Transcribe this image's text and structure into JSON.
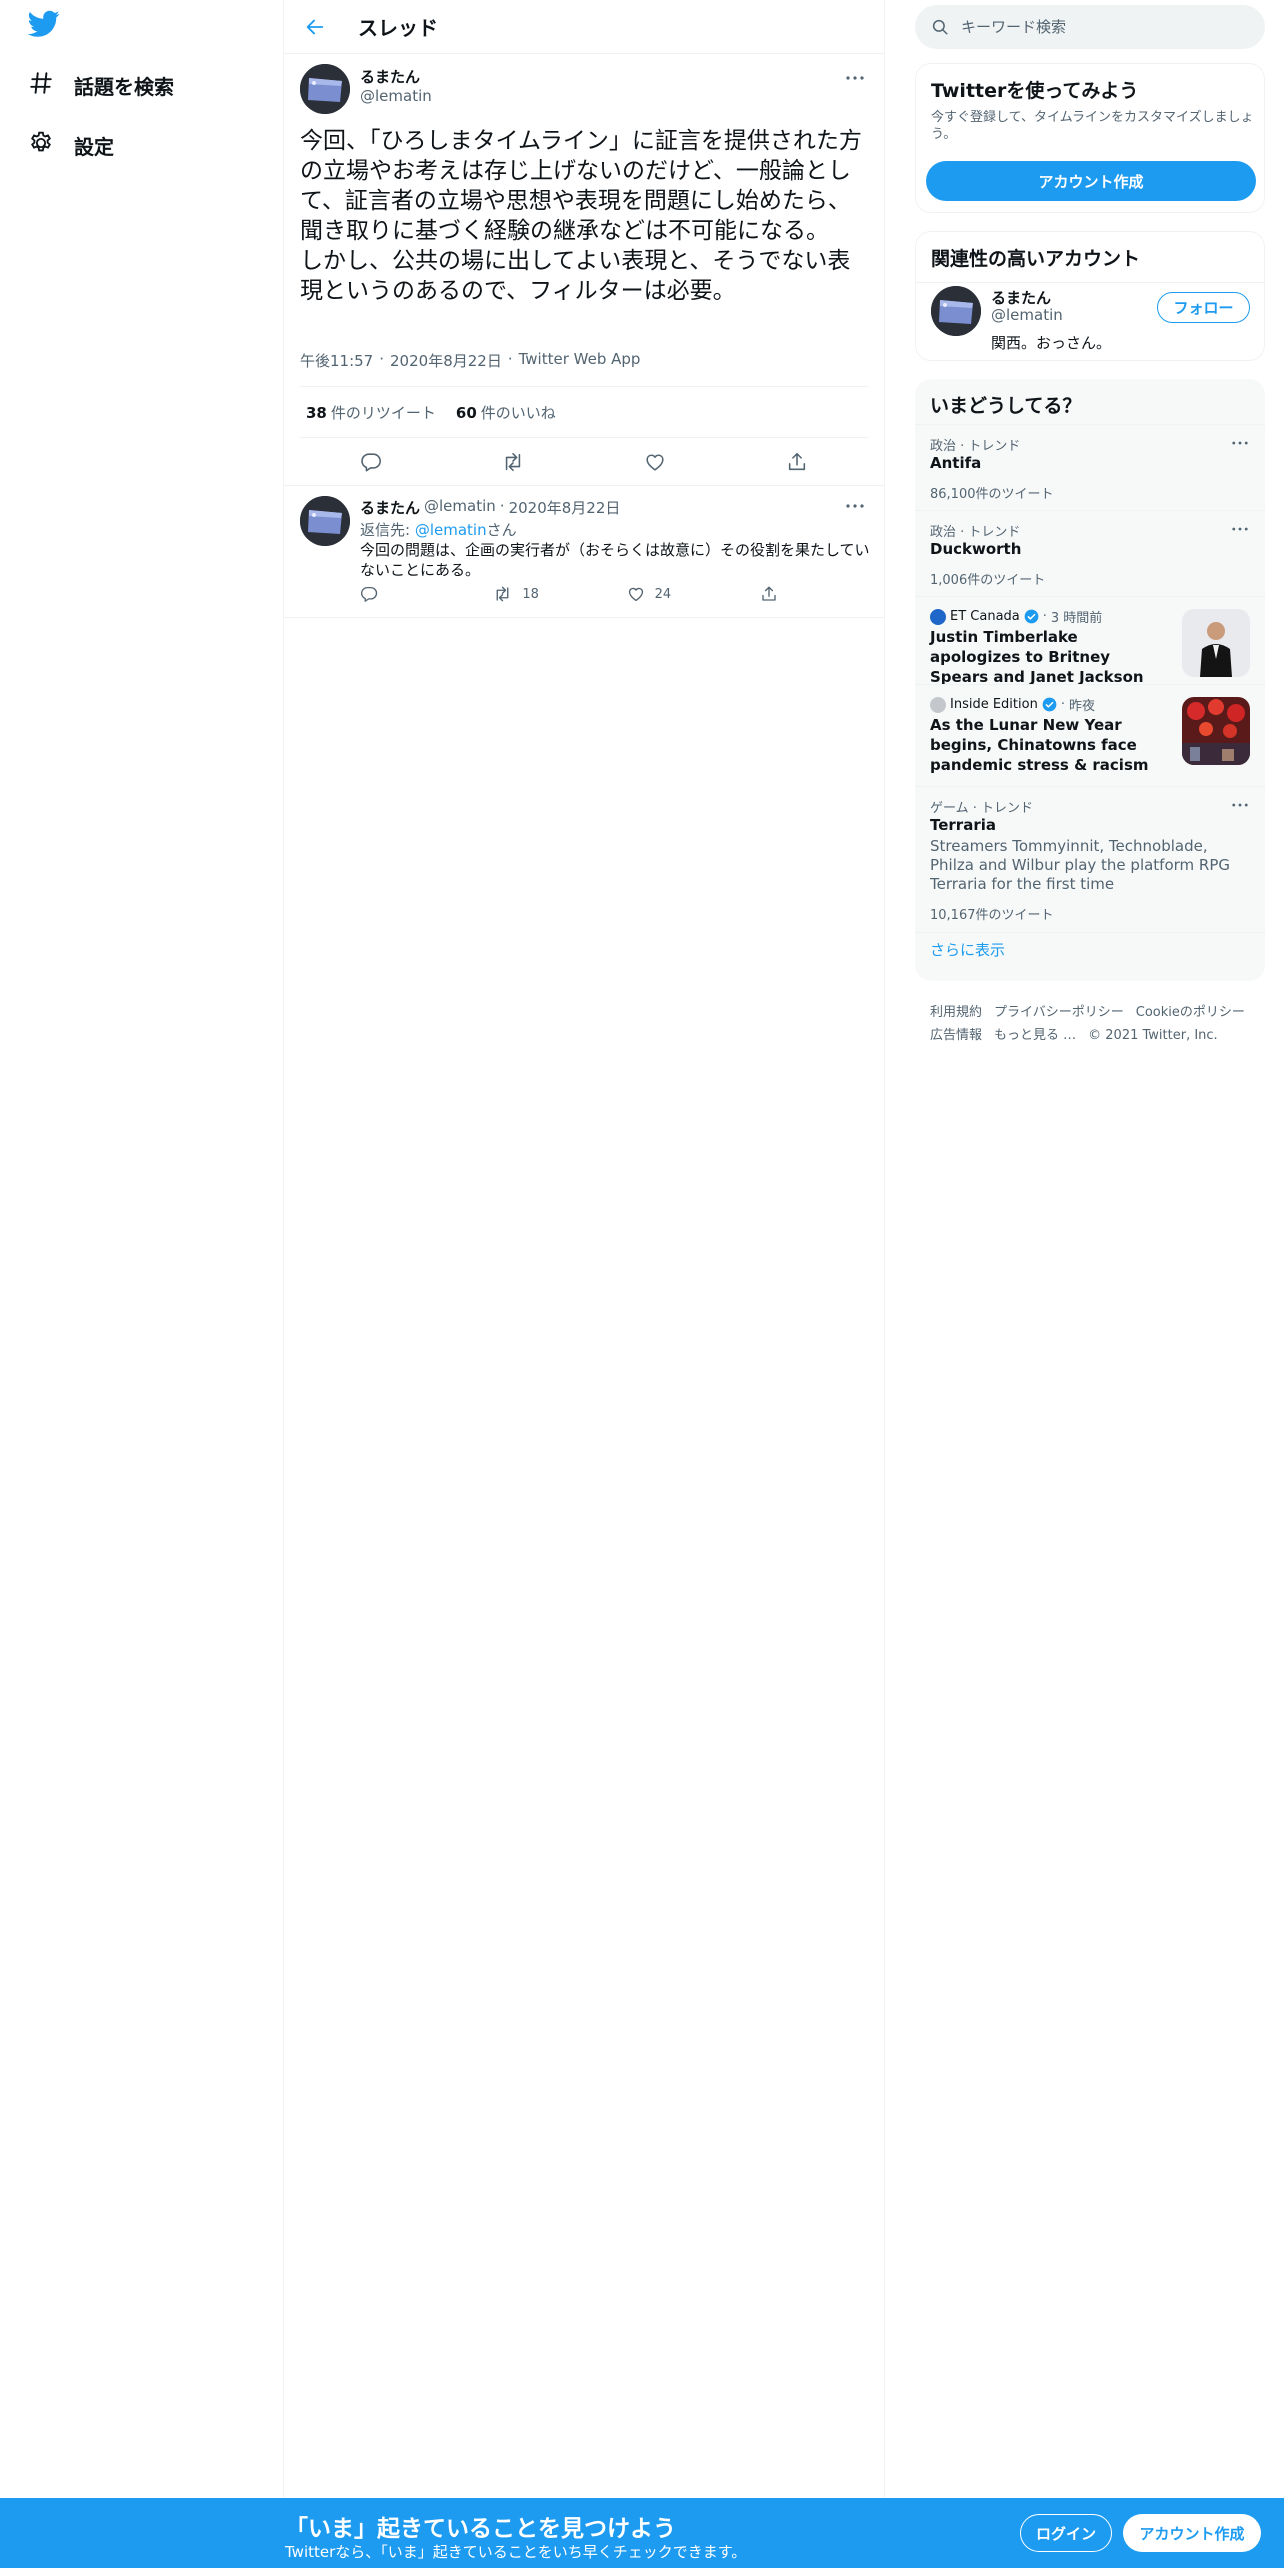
{
  "colors": {
    "accent": "#1d9bf0",
    "text": "#0f1419",
    "muted": "#536471",
    "border": "#eff3f4"
  },
  "nav": {
    "logo_icon": "twitter-bird-icon",
    "items": [
      {
        "icon": "hashtag-icon",
        "label": "話題を検索"
      },
      {
        "icon": "gear-icon",
        "label": "設定"
      }
    ]
  },
  "header": {
    "title": "スレッド"
  },
  "tweet": {
    "name": "るまたん",
    "handle": "@lematin",
    "text": "今回、「ひろしまタイムライン」に証言を提供された方の立場やお考えは存じ上げないのだけど、一般論として、証言者の立場や思想や表現を問題にし始めたら、聞き取りに基づく経験の継承などは不可能になる。\nしかし、公共の場に出してよい表現と、そうでない表現というのあるので、フィルターは必要。",
    "time": "午後11:57",
    "date": "2020年8月22日",
    "source": "Twitter Web App",
    "sep": "·",
    "retweets": "38",
    "retweets_label": "件のリツイート",
    "likes": "60",
    "likes_label": "件のいいね"
  },
  "reply": {
    "name": "るまたん",
    "handle": "@lematin",
    "sep": "·",
    "date": "2020年8月22日",
    "replying_prefix": "返信先: ",
    "replying_mention": "@lematin",
    "replying_suffix": "さん",
    "text": "今回の問題は、企画の実行者が（おそらくは故意に）その役割を果たしていないことにある。",
    "retweets": "18",
    "likes": "24"
  },
  "search": {
    "placeholder": "キーワード検索"
  },
  "signup_card": {
    "title": "Twitterを使ってみよう",
    "subtitle": "今すぐ登録して、タイムラインをカスタマイズしましょう。",
    "button": "アカウント作成"
  },
  "related": {
    "title": "関連性の高いアカウント",
    "name": "るまたん",
    "handle": "@lematin",
    "bio": "関西。おっさん。",
    "follow": "フォロー"
  },
  "trends": {
    "title": "いまどうしてる？",
    "items": [
      {
        "context": "政治 · トレンド",
        "name": "Antifa",
        "count": "86,100件のツイート"
      },
      {
        "context": "政治 · トレンド",
        "name": "Duckworth",
        "count": "1,006件のツイート"
      },
      {
        "source": "ET Canada",
        "sep": "·",
        "time": "3 時間前",
        "headline": "Justin Timberlake apologizes to Britney Spears and Janet Jackson"
      },
      {
        "source": "Inside Edition",
        "sep": "·",
        "time": "昨夜",
        "headline": "As the Lunar New Year begins, Chinatowns face pandemic stress & racism"
      },
      {
        "context": "ゲーム · トレンド",
        "name": "Terraria",
        "description": "Streamers Tommyinnit, Technoblade, Philza and Wilbur play the platform RPG Terraria for the first time",
        "count": "10,167件のツイート"
      }
    ],
    "show_more": "さらに表示"
  },
  "footer": {
    "links": [
      "利用規約",
      "プライバシーポリシー",
      "Cookieのポリシー",
      "広告情報",
      "もっと見る …"
    ],
    "copyright": "© 2021 Twitter, Inc."
  },
  "bottom_bar": {
    "title": "「いま」起きていることを見つけよう",
    "subtitle": "Twitterなら、「いま」起きていることをいち早くチェックできます。",
    "login": "ログイン",
    "signup": "アカウント作成"
  }
}
